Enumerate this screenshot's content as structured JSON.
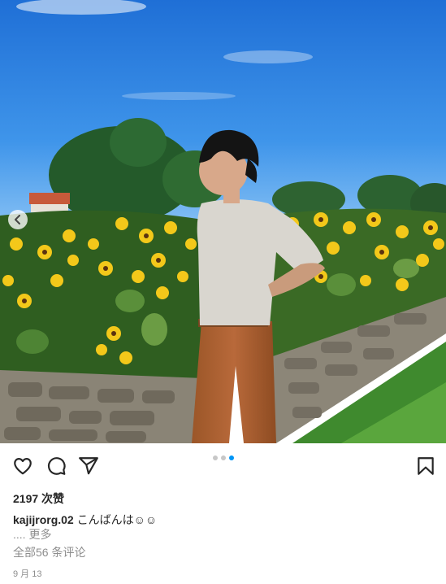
{
  "post": {
    "image_alt": "Young man in a light grey shirt and brown trousers standing in front of sunflowers and a stone wall under a blue sky",
    "carousel": {
      "count": 3,
      "active_index": 2
    },
    "likes_text": "2197 次赞",
    "caption": {
      "username": "kajijrorg.02",
      "text": "こんばんは☺☺"
    },
    "more_text": ".... 更多",
    "comments_text": "全部56 条评论",
    "date_text": "9 月 13"
  },
  "icons": [
    "heart-icon",
    "comment-icon",
    "share-icon",
    "bookmark-icon",
    "chevron-left-icon"
  ],
  "colors": {
    "accent": "#0095f6",
    "text": "#262626",
    "muted": "#8e8e8e"
  }
}
